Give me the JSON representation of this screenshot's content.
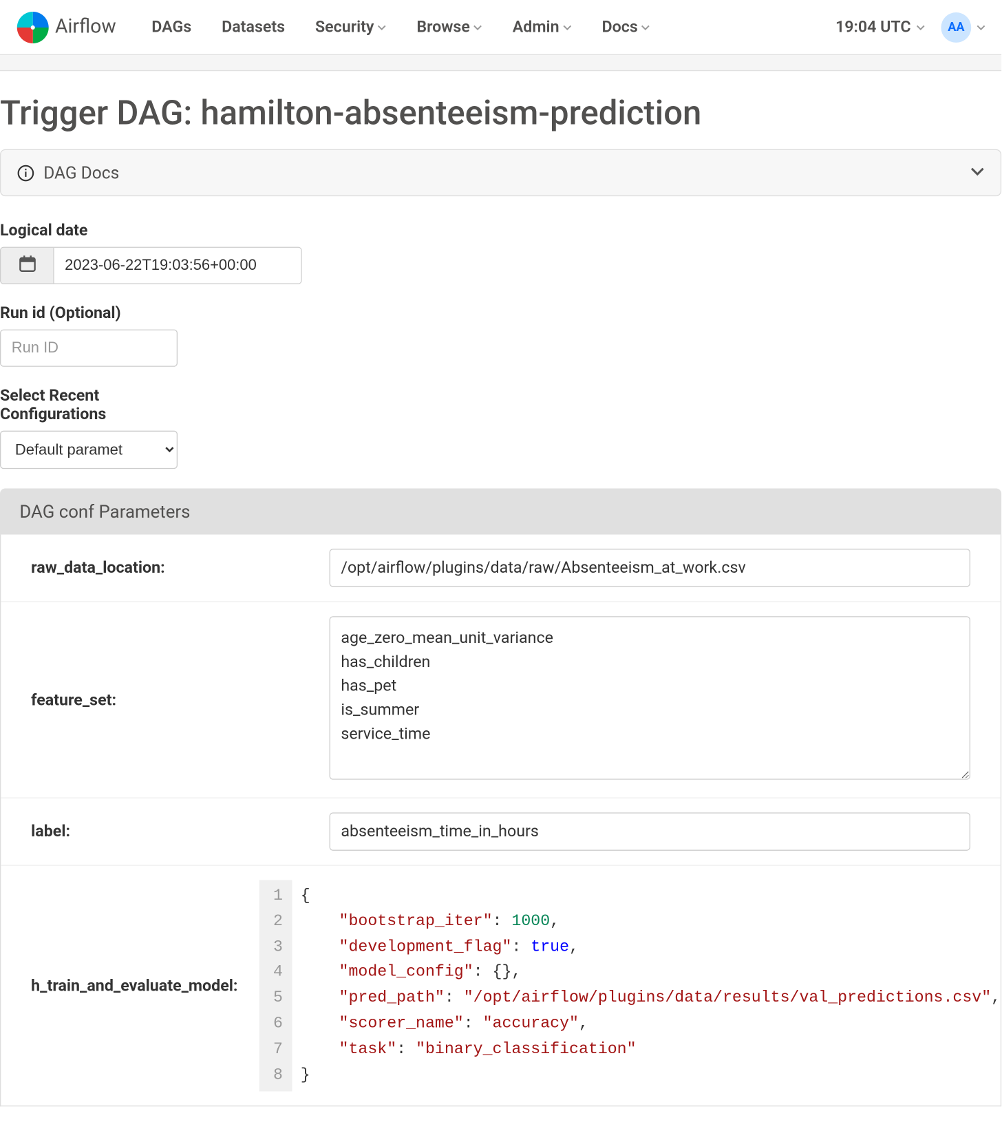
{
  "brand": "Airflow",
  "nav": {
    "dags": "DAGs",
    "datasets": "Datasets",
    "security": "Security",
    "browse": "Browse",
    "admin": "Admin",
    "docs": "Docs"
  },
  "header_right": {
    "time": "19:04 UTC",
    "avatar": "AA"
  },
  "page_title": "Trigger DAG: hamilton-absenteeism-prediction",
  "dag_docs_label": "DAG Docs",
  "form": {
    "logical_date_label": "Logical date",
    "logical_date_value": "2023-06-22T19:03:56+00:00",
    "run_id_label": "Run id (Optional)",
    "run_id_placeholder": "Run ID",
    "select_recent_label_1": "Select Recent",
    "select_recent_label_2": "Configurations",
    "select_value": "Default paramet"
  },
  "conf": {
    "heading": "DAG conf Parameters",
    "raw_data_location": {
      "label": "raw_data_location:",
      "value": "/opt/airflow/plugins/data/raw/Absenteeism_at_work.csv"
    },
    "feature_set": {
      "label": "feature_set:",
      "value": "age_zero_mean_unit_variance\nhas_children\nhas_pet\nis_summer\nservice_time"
    },
    "label": {
      "label": "label:",
      "value": "absenteeism_time_in_hours"
    },
    "h_train": {
      "label": "h_train_and_evaluate_model:",
      "json": {
        "bootstrap_iter": 1000,
        "development_flag": true,
        "model_config": {},
        "pred_path": "/opt/airflow/plugins/data/results/val_predictions.csv",
        "scorer_name": "accuracy",
        "task": "binary_classification"
      }
    }
  }
}
